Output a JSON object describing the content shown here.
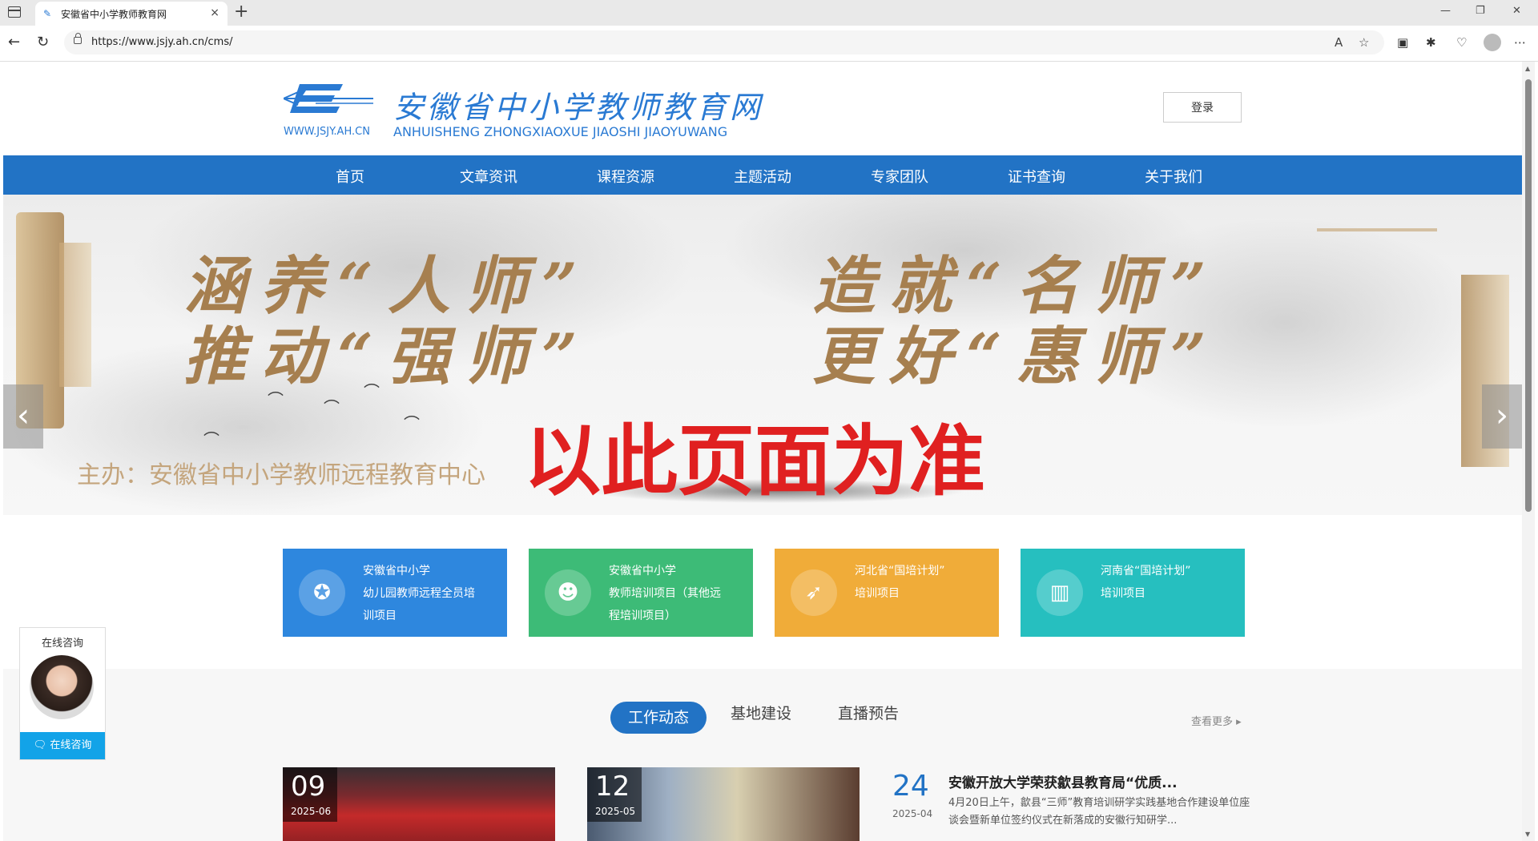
{
  "browser": {
    "tab_title": "安徽省中小学教师教育网",
    "url": "https://www.jsjy.ah.cn/cms/",
    "tab_close": "×",
    "new_tab": "+",
    "min": "—",
    "max": "❐",
    "close": "✕"
  },
  "header": {
    "site_abbr": "WWW.JSJY.AH.CN",
    "title_cn": "安徽省中小学教师教育网",
    "title_en": "ANHUISHENG ZHONGXIAOXUE JIAOSHI JIAOYUWANG",
    "login": "登录"
  },
  "nav": [
    "首页",
    "文章资讯",
    "课程资源",
    "主题活动",
    "专家团队",
    "证书查询",
    "关于我们"
  ],
  "banner": {
    "line1_left": "涵养“人师”",
    "line1_right": "造就“名师”",
    "line2_left": "推动“强师”",
    "line2_right": "更好“惠师”",
    "organizer": "主办：安徽省中小学教师远程教育中心",
    "overlay": "以此页面为准",
    "prev": "‹",
    "next": "›",
    "slide_count": 8,
    "active_slide": 2
  },
  "cards": [
    {
      "lines": [
        "安徽省中小学",
        "幼儿园教师远程全员培",
        "训项目"
      ],
      "color": "#2e87de",
      "icon": "medal-icon"
    },
    {
      "lines": [
        "安徽省中小学",
        "教师培训项目（其他远",
        "程培训项目）"
      ],
      "color": "#3dbb77",
      "icon": "group-icon"
    },
    {
      "lines": [
        "河北省“国培计划”",
        "培训项目"
      ],
      "color": "#f0ac39",
      "icon": "rocket-icon"
    },
    {
      "lines": [
        "河南省“国培计划”",
        "培训项目"
      ],
      "color": "#26bfbf",
      "icon": "book-icon"
    }
  ],
  "news_tabs": [
    "工作动态",
    "基地建设",
    "直播预告"
  ],
  "more": "查看更多 ▸",
  "news": [
    {
      "day": "09",
      "ym": "2025-06"
    },
    {
      "day": "12",
      "ym": "2025-05"
    }
  ],
  "news_text": {
    "day": "24",
    "ym": "2025-04",
    "headline": "安徽开放大学荣获歙县教育局“优质...",
    "summary": "4月20日上午，歙县“三师”教育培训研学实践基地合作建设单位座谈会暨新单位签约仪式在新落成的安徽行知研学..."
  },
  "consult": {
    "label": "在线咨询",
    "button": "在线咨询"
  },
  "colors": {
    "nav_bg": "#2273c5",
    "brand": "#2a7ad3",
    "overlay_red": "#e02020"
  }
}
